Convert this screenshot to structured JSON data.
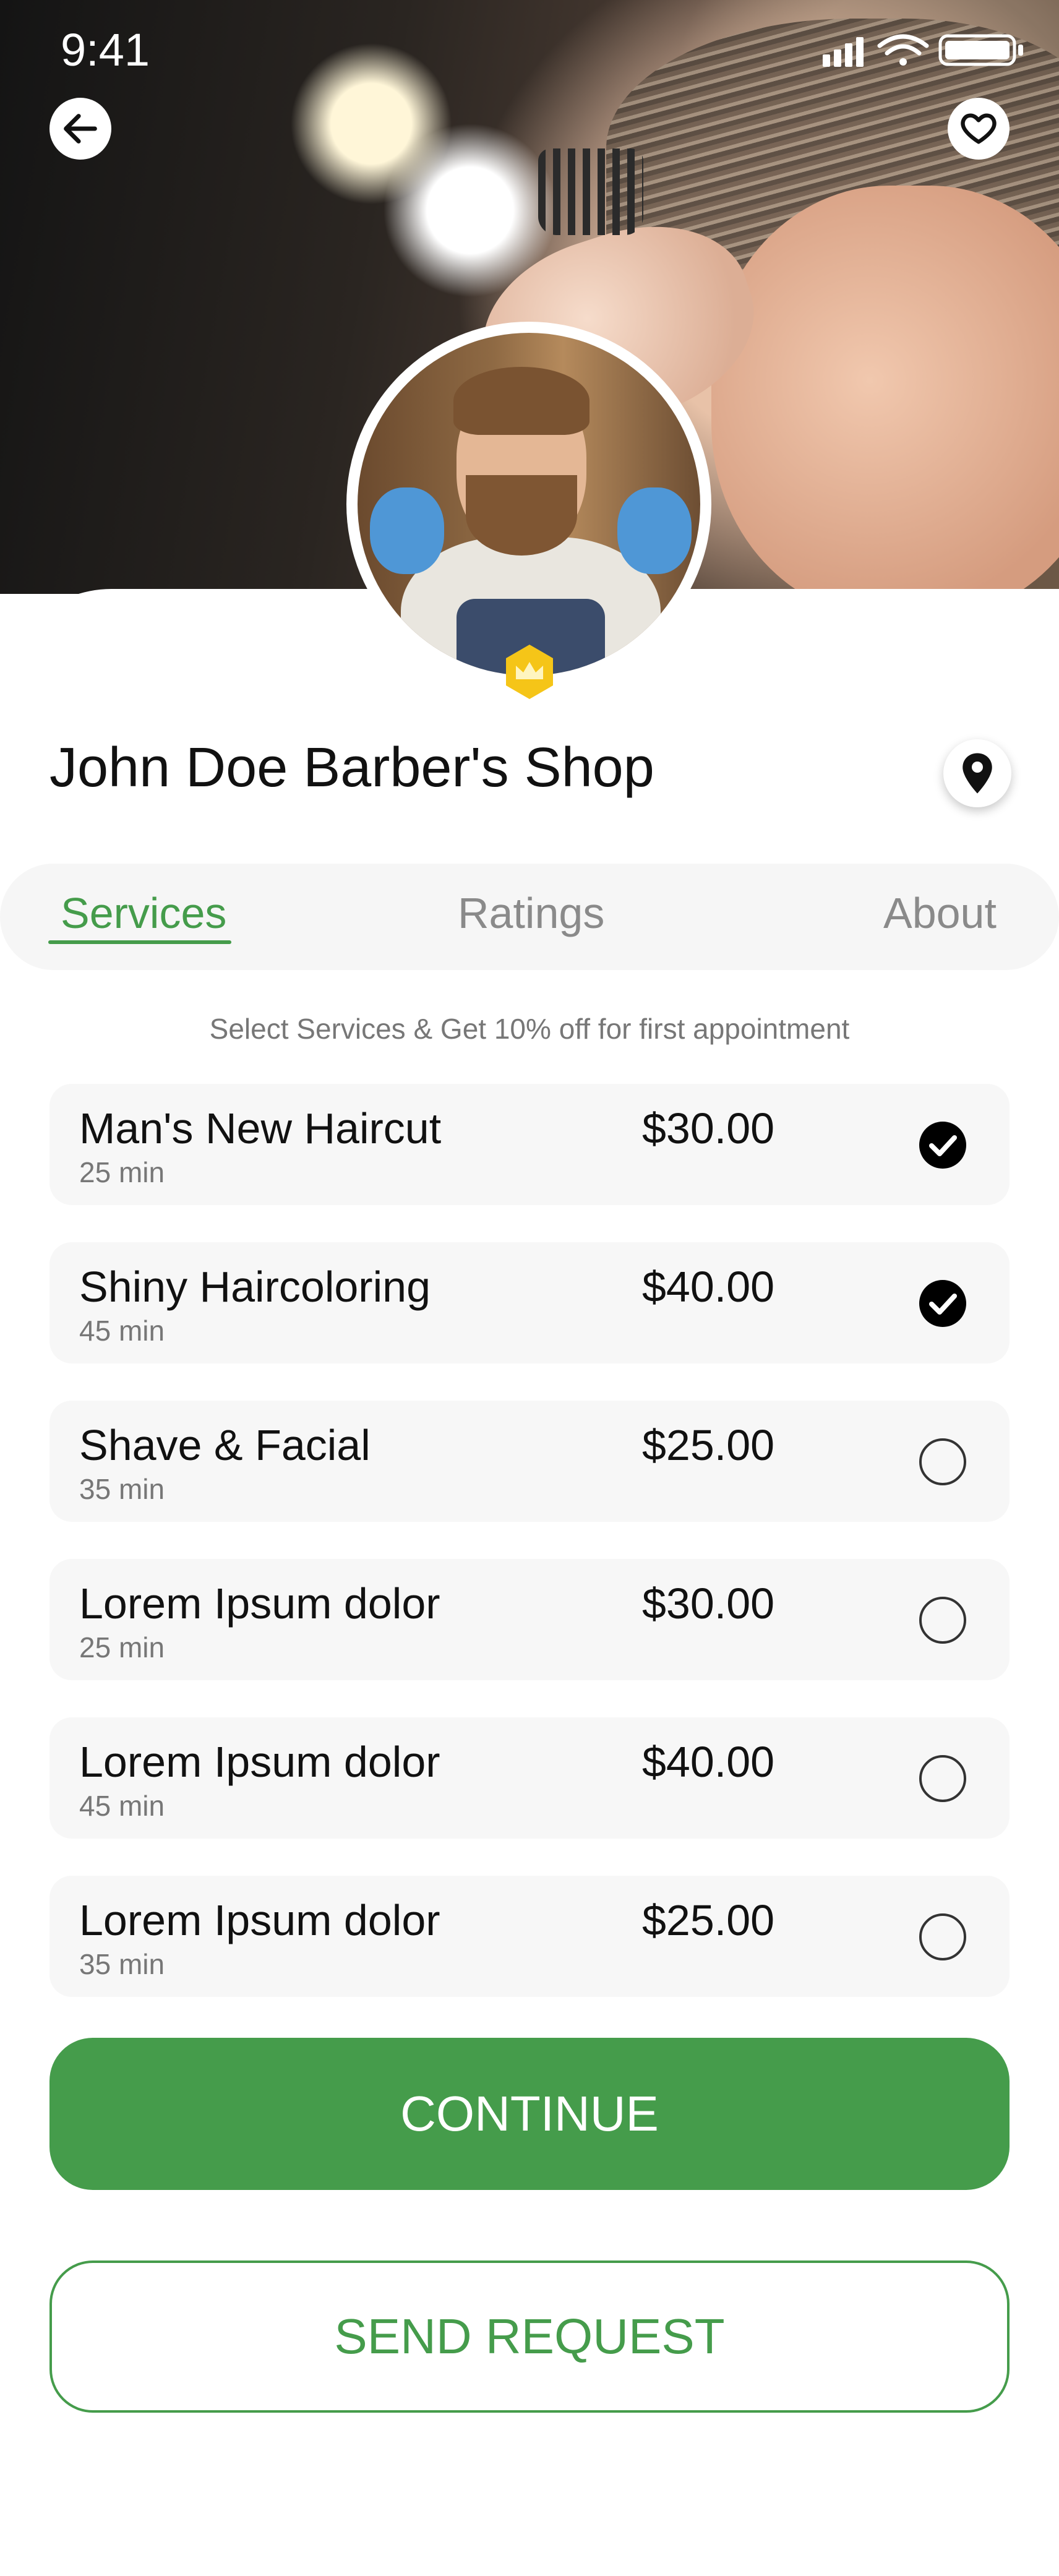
{
  "status_bar": {
    "time": "9:41"
  },
  "header": {
    "back_icon": "arrow-left-icon",
    "favorite_icon": "heart-icon",
    "verified_badge_icon": "crown-icon"
  },
  "shop": {
    "name": "John Doe Barber's Shop",
    "location_icon": "map-pin-icon"
  },
  "tabs": [
    {
      "label": "Services",
      "active": true
    },
    {
      "label": "Ratings",
      "active": false
    },
    {
      "label": "About",
      "active": false
    }
  ],
  "promo": {
    "text": "Select Services & Get 10% off for first appointment"
  },
  "services": [
    {
      "name": "Man's New Haircut",
      "duration": "25 min",
      "price": "$30.00",
      "selected": true
    },
    {
      "name": "Shiny Haircoloring",
      "duration": "45 min",
      "price": "$40.00",
      "selected": true
    },
    {
      "name": "Shave & Facial",
      "duration": "35 min",
      "price": "$25.00",
      "selected": false
    },
    {
      "name": "Lorem Ipsum dolor",
      "duration": "25 min",
      "price": "$30.00",
      "selected": false
    },
    {
      "name": "Lorem Ipsum dolor",
      "duration": "45 min",
      "price": "$40.00",
      "selected": false
    },
    {
      "name": "Lorem Ipsum dolor",
      "duration": "35 min",
      "price": "$25.00",
      "selected": false
    }
  ],
  "actions": {
    "continue_label": "CONTINUE",
    "send_request_label": "SEND REQUEST"
  },
  "colors": {
    "accent": "#459c4b",
    "badge": "#f5c518",
    "card_bg": "#f7f7f7"
  }
}
